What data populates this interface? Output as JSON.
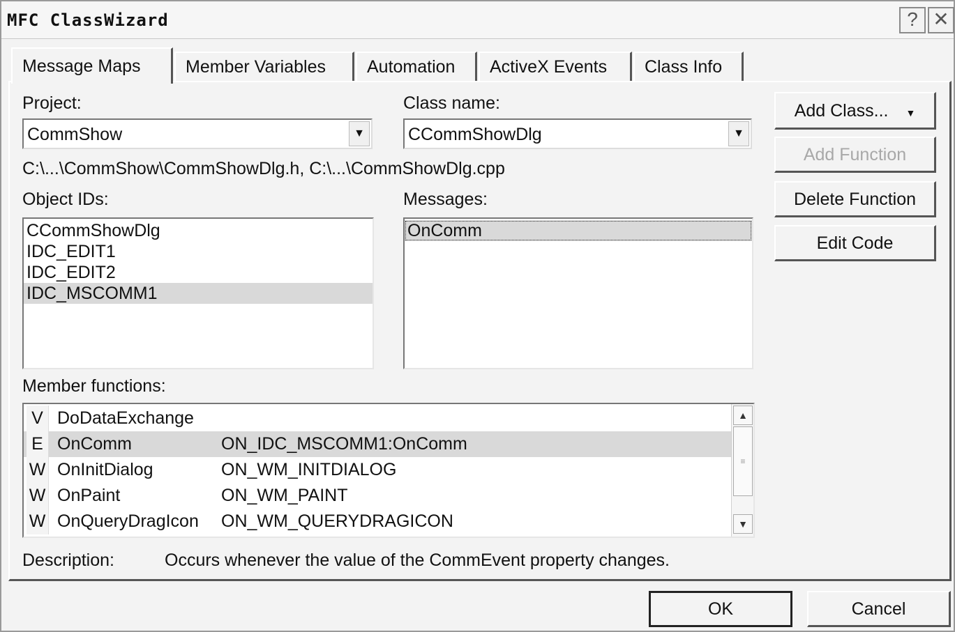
{
  "window": {
    "title": "MFC ClassWizard",
    "help_glyph": "?",
    "close_glyph": "✕"
  },
  "tabs": [
    {
      "label": "Message Maps",
      "active": true
    },
    {
      "label": "Member Variables",
      "active": false
    },
    {
      "label": "Automation",
      "active": false
    },
    {
      "label": "ActiveX Events",
      "active": false
    },
    {
      "label": "Class Info",
      "active": false
    }
  ],
  "project": {
    "label": "Project:",
    "value": "CommShow"
  },
  "class_name": {
    "label": "Class name:",
    "value": "CCommShowDlg"
  },
  "file_path": "C:\\...\\CommShow\\CommShowDlg.h, C:\\...\\CommShowDlg.cpp",
  "object_ids": {
    "label": "Object IDs:",
    "items": [
      "CCommShowDlg",
      "IDC_EDIT1",
      "IDC_EDIT2",
      "IDC_MSCOMM1"
    ],
    "selected": "IDC_MSCOMM1"
  },
  "messages": {
    "label": "Messages:",
    "items": [
      "OnComm"
    ],
    "selected": "OnComm"
  },
  "member_functions": {
    "label": "Member functions:",
    "rows": [
      {
        "type": "V",
        "name": "DoDataExchange",
        "map": ""
      },
      {
        "type": "E",
        "name": "OnComm",
        "map": "ON_IDC_MSCOMM1:OnComm"
      },
      {
        "type": "W",
        "name": "OnInitDialog",
        "map": "ON_WM_INITDIALOG"
      },
      {
        "type": "W",
        "name": "OnPaint",
        "map": "ON_WM_PAINT"
      },
      {
        "type": "W",
        "name": "OnQueryDragIcon",
        "map": "ON_WM_QUERYDRAGICON"
      }
    ],
    "selected": "OnComm"
  },
  "description": {
    "label": "Description:",
    "text": "Occurs whenever the value of the CommEvent property changes."
  },
  "buttons": {
    "add_class": "Add Class...",
    "add_function": "Add Function",
    "delete_function": "Delete Function",
    "edit_code": "Edit Code",
    "ok": "OK",
    "cancel": "Cancel"
  }
}
